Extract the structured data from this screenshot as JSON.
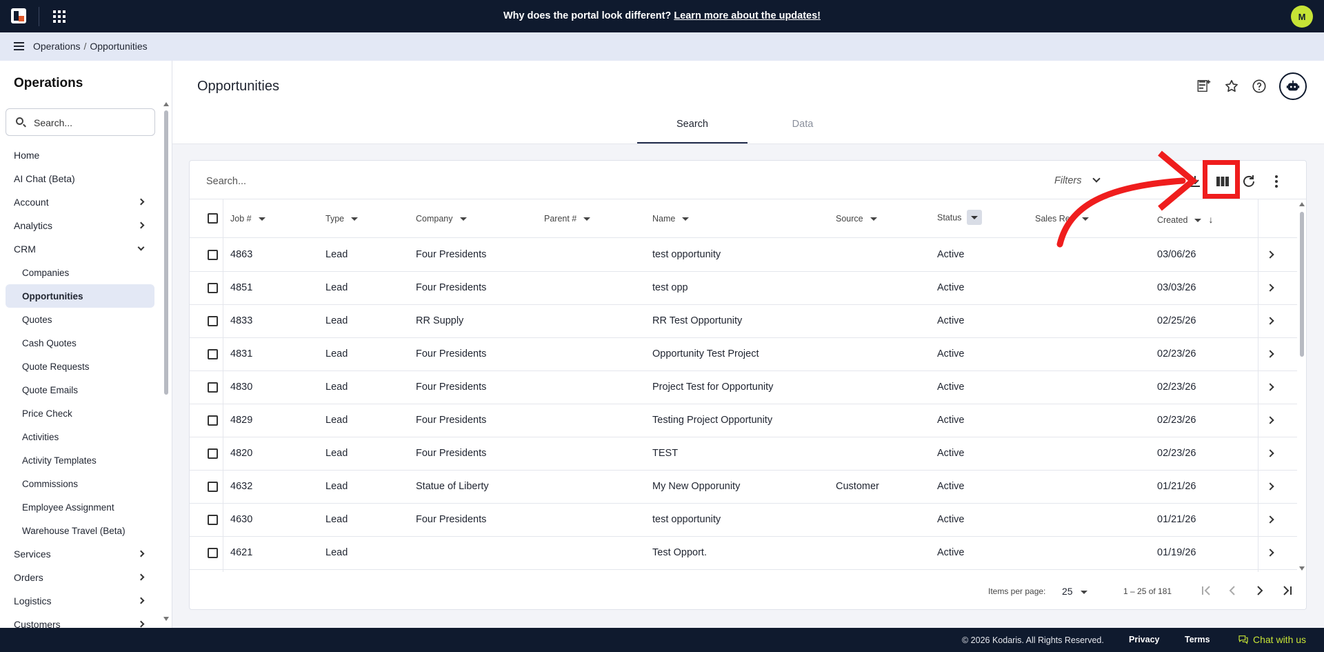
{
  "topbar": {
    "banner_text": "Why does the portal look different?",
    "banner_link": "Learn more about the updates!",
    "avatar_initial": "M"
  },
  "breadcrumb": {
    "items": [
      "Operations",
      "Opportunities"
    ]
  },
  "sidebar": {
    "title": "Operations",
    "search_placeholder": "Search...",
    "items": [
      {
        "label": "Home",
        "type": "top"
      },
      {
        "label": "AI Chat (Beta)",
        "type": "top"
      },
      {
        "label": "Account",
        "type": "expandable"
      },
      {
        "label": "Analytics",
        "type": "expandable"
      },
      {
        "label": "CRM",
        "type": "expanded"
      },
      {
        "label": "Companies",
        "type": "sub"
      },
      {
        "label": "Opportunities",
        "type": "sub-active"
      },
      {
        "label": "Quotes",
        "type": "sub"
      },
      {
        "label": "Cash Quotes",
        "type": "sub"
      },
      {
        "label": "Quote Requests",
        "type": "sub"
      },
      {
        "label": "Quote Emails",
        "type": "sub"
      },
      {
        "label": "Price Check",
        "type": "sub"
      },
      {
        "label": "Activities",
        "type": "sub"
      },
      {
        "label": "Activity Templates",
        "type": "sub"
      },
      {
        "label": "Commissions",
        "type": "sub"
      },
      {
        "label": "Employee Assignment",
        "type": "sub"
      },
      {
        "label": "Warehouse Travel (Beta)",
        "type": "sub"
      },
      {
        "label": "Services",
        "type": "expandable"
      },
      {
        "label": "Orders",
        "type": "expandable"
      },
      {
        "label": "Logistics",
        "type": "expandable"
      },
      {
        "label": "Customers",
        "type": "expandable"
      }
    ]
  },
  "main": {
    "title": "Opportunities",
    "tabs": [
      {
        "label": "Search",
        "active": true
      },
      {
        "label": "Data",
        "active": false
      }
    ],
    "search_placeholder": "Search...",
    "filters_label": "Filters"
  },
  "table": {
    "columns": [
      "Job #",
      "Type",
      "Company",
      "Parent #",
      "Name",
      "Source",
      "Status",
      "Sales Rep",
      "Created"
    ],
    "rows": [
      [
        "4863",
        "Lead",
        "Four Presidents",
        "",
        "test opportunity",
        "",
        "Active",
        "",
        "03/06/26"
      ],
      [
        "4851",
        "Lead",
        "Four Presidents",
        "",
        "test opp",
        "",
        "Active",
        "",
        "03/03/26"
      ],
      [
        "4833",
        "Lead",
        "RR Supply",
        "",
        "RR Test Opportunity",
        "",
        "Active",
        "",
        "02/25/26"
      ],
      [
        "4831",
        "Lead",
        "Four Presidents",
        "",
        "Opportunity Test Project",
        "",
        "Active",
        "",
        "02/23/26"
      ],
      [
        "4830",
        "Lead",
        "Four Presidents",
        "",
        "Project Test for Opportunity",
        "",
        "Active",
        "",
        "02/23/26"
      ],
      [
        "4829",
        "Lead",
        "Four Presidents",
        "",
        "Testing Project Opportunity",
        "",
        "Active",
        "",
        "02/23/26"
      ],
      [
        "4820",
        "Lead",
        "Four Presidents",
        "",
        "TEST",
        "",
        "Active",
        "",
        "02/23/26"
      ],
      [
        "4632",
        "Lead",
        "Statue of Liberty",
        "",
        "My New Opporunity",
        "Customer",
        "Active",
        "",
        "01/21/26"
      ],
      [
        "4630",
        "Lead",
        "Four Presidents",
        "",
        "test opportunity",
        "",
        "Active",
        "",
        "01/21/26"
      ],
      [
        "4621",
        "Lead",
        "",
        "",
        "Test Opport.",
        "",
        "Active",
        "",
        "01/19/26"
      ]
    ]
  },
  "paginator": {
    "items_per_page_label": "Items per page:",
    "page_size": "25",
    "range": "1 – 25 of 181"
  },
  "footer": {
    "copyright": "© 2026 Kodaris. All Rights Reserved.",
    "privacy": "Privacy",
    "terms": "Terms",
    "chat": "Chat with us"
  },
  "colors": {
    "topbar": "#0f1a2e",
    "accent_lime": "#c6e336",
    "annotation_red": "#ef1d1d",
    "active_nav_bg": "#e3e8f5"
  }
}
